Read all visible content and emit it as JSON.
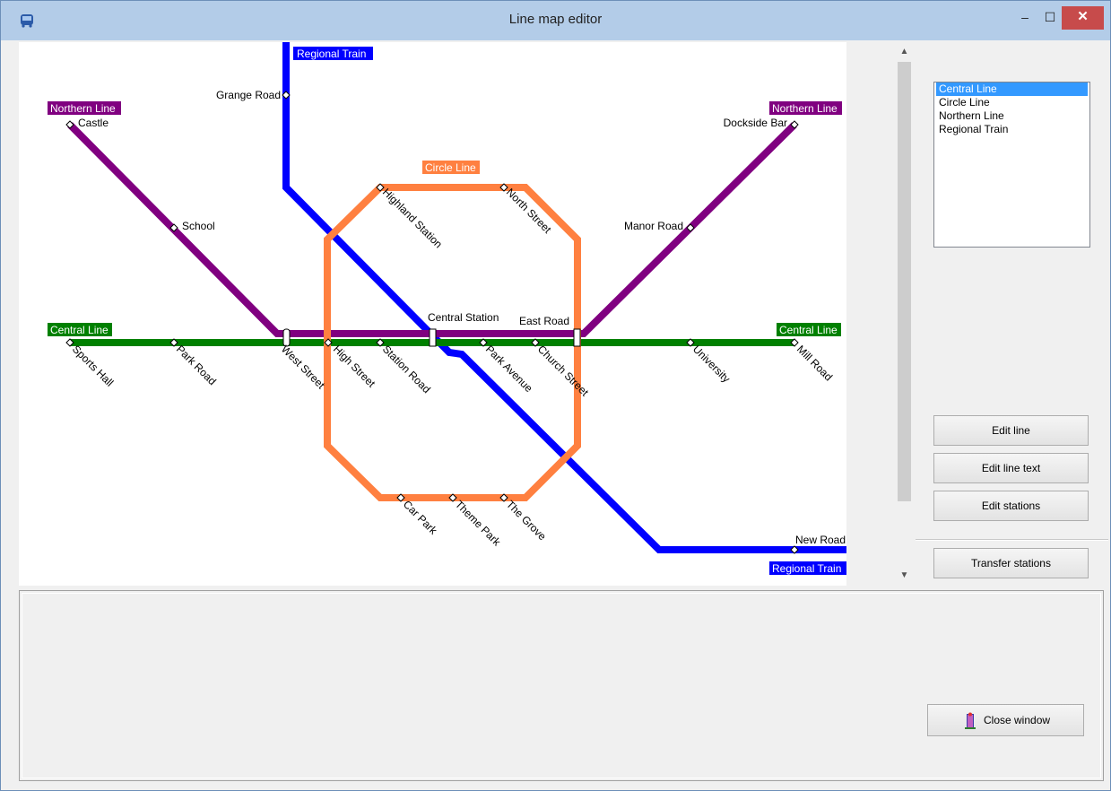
{
  "window": {
    "title": "Line map editor",
    "min": "–",
    "max": "☐",
    "close": "✕"
  },
  "lines": [
    {
      "name": "Central Line",
      "color": "#008000"
    },
    {
      "name": "Circle Line",
      "color": "#ff8040"
    },
    {
      "name": "Northern Line",
      "color": "#800080"
    },
    {
      "name": "Regional Train",
      "color": "#0000ff"
    }
  ],
  "line_labels": {
    "regional_top": "Regional Train",
    "regional_bottom": "Regional Train",
    "northern_left": "Northern Line",
    "northern_right": "Northern Line",
    "circle": "Circle Line",
    "central_left": "Central Line",
    "central_right": "Central Line"
  },
  "stations": {
    "grange_road": "Grange Road",
    "castle": "Castle",
    "dockside_bar": "Dockside Bar",
    "school": "School",
    "manor_road": "Manor Road",
    "highland_station": "Highland Station",
    "north_street": "North Street",
    "central_station": "Central Station",
    "east_road": "East Road",
    "sports_hall": "Sports Hall",
    "park_road": "Park Road",
    "west_street": "West Street",
    "high_street": "High Street",
    "station_road": "Station Road",
    "park_avenue": "Park Avenue",
    "church_street": "Church Street",
    "university": "University",
    "mill_road": "Mill Road",
    "car_park": "Car Park",
    "theme_park": "Theme Park",
    "the_grove": "The Grove",
    "new_road": "New Road"
  },
  "buttons": {
    "edit_line": "Edit line",
    "edit_line_text": "Edit line text",
    "edit_stations": "Edit stations",
    "transfer_stations": "Transfer stations",
    "close_window": "Close window"
  },
  "icons": {
    "app": "bus-icon",
    "close_window": "door-exit-icon",
    "scroll_up": "▲",
    "scroll_down": "▼"
  }
}
